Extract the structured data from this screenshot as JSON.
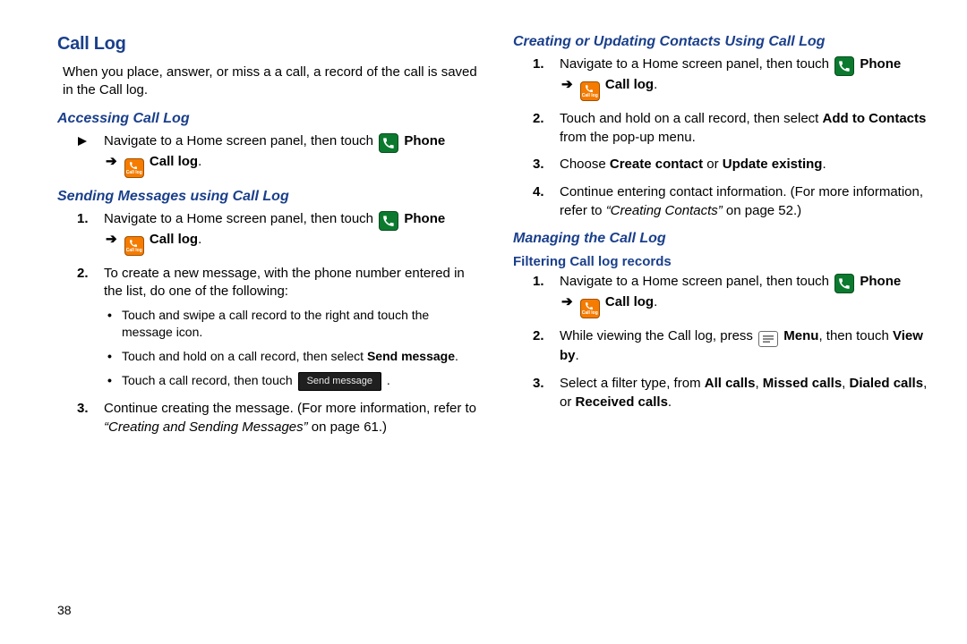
{
  "page_number": "38",
  "left": {
    "h1": "Call Log",
    "intro": "When you place, answer, or miss a a call, a record of the call is saved in the Call log.",
    "sec1": {
      "title": "Accessing Call Log",
      "step_pre": "Navigate to a Home screen panel, then touch ",
      "phone_label": "Phone",
      "calllog_label": "Call log"
    },
    "sec2": {
      "title": "Sending Messages using Call Log",
      "s1_pre": "Navigate to a Home screen panel, then touch ",
      "phone_label": "Phone",
      "calllog_label": "Call log",
      "s2": "To create a new message, with the phone number entered in the list, do one of the following:",
      "b1": "Touch and swipe a call record to the right and touch the message icon.",
      "b2_pre": "Touch and hold on a call record, then select ",
      "b2_bold": "Send message",
      "b2_post": ".",
      "b3_pre": "Touch a call record, then touch ",
      "b3_btn": "Send message",
      "b3_post": " .",
      "s3_pre": "Continue creating the message. (For more information, refer to ",
      "s3_ref": "“Creating and Sending Messages”",
      "s3_post": " on page 61.)"
    }
  },
  "right": {
    "sec3": {
      "title": "Creating or Updating Contacts Using Call Log",
      "s1_pre": "Navigate to a Home screen panel, then touch ",
      "phone_label": "Phone",
      "calllog_label": "Call log",
      "s2_pre": "Touch and hold on a call record, then select ",
      "s2_bold": "Add to Contacts",
      "s2_post": " from the pop-up menu.",
      "s3_pre": "Choose ",
      "s3_b1": "Create contact",
      "s3_mid": " or ",
      "s3_b2": "Update existing",
      "s3_post": ".",
      "s4_pre": "Continue entering contact information. (For more information, refer to ",
      "s4_ref": "“Creating Contacts”",
      "s4_post": " on page 52.)"
    },
    "sec4": {
      "title": "Managing the Call Log",
      "sub": "Filtering Call log records",
      "s1_pre": "Navigate to a Home screen panel, then touch ",
      "phone_label": "Phone",
      "calllog_label": "Call log",
      "s2_pre": "While viewing the Call log, press ",
      "menu_label": "Menu",
      "s2_mid": ", then touch ",
      "viewby": "View by",
      "s2_post": ".",
      "s3_pre": "Select a filter type, from ",
      "all": "All calls",
      "c1": ", ",
      "missed": "Missed calls",
      "c2": ", ",
      "dialed": "Dialed calls",
      "c3": ", or ",
      "received": "Received calls",
      "s3_post": "."
    }
  },
  "icons": {
    "calllog_small_text": "Call log"
  }
}
